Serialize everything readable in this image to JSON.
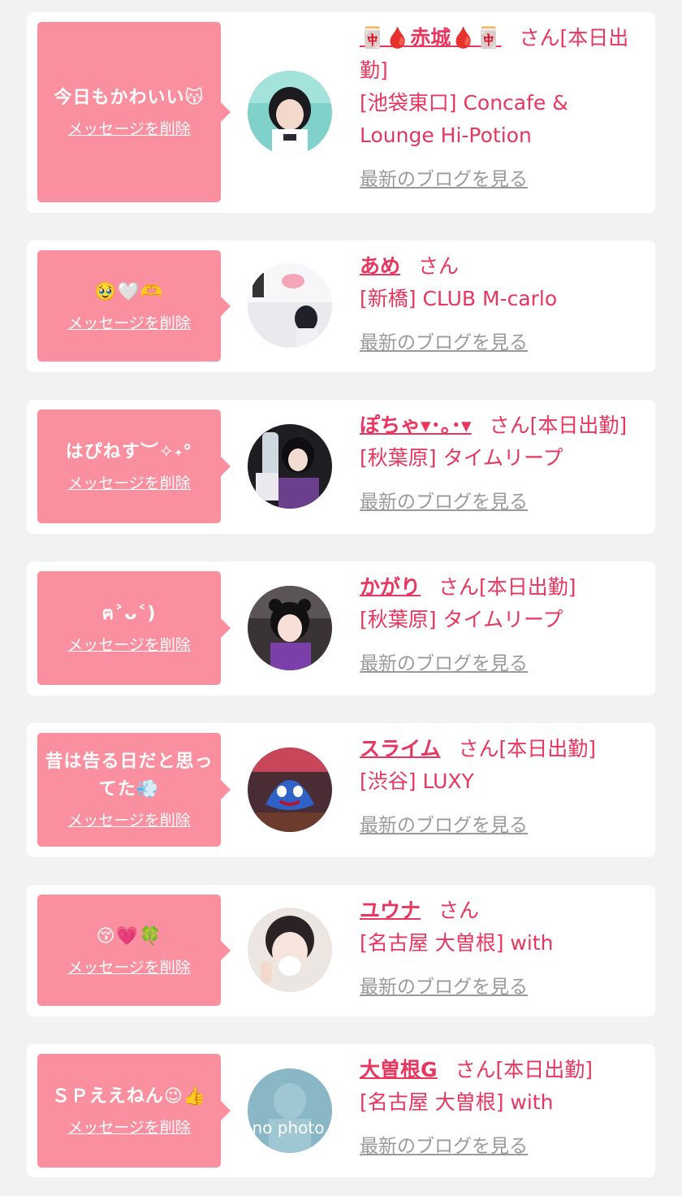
{
  "delete_label": "メッセージを削除",
  "blog_label": "最新のブログを見る",
  "colors": {
    "background": "#f2f2f2",
    "card": "#ffffff",
    "bubble": "#fa8f9f",
    "accent_text": "#e8365f",
    "muted_text": "#9a9a9a"
  },
  "cards": [
    {
      "message": "今日もかわいい😽",
      "name": "🀄🩸赤城🩸🀄",
      "honorific": "さん",
      "status": "[本日出勤]",
      "shop": "[池袋東口] Concafe & Lounge Hi-Potion",
      "avatar_icon": "profile-photo-icon"
    },
    {
      "message": "🥹🤍🫶",
      "name": "あめ",
      "honorific": "さん",
      "status": "",
      "shop": "[新橋] CLUB M-carlo",
      "avatar_icon": "profile-photo-icon"
    },
    {
      "message": "はぴねす︶✧˖°",
      "name": "ぽちゃ▾･｡･▾",
      "honorific": "さん",
      "status": "[本日出勤]",
      "shop": "[秋葉原] タイムリープ",
      "avatar_icon": "profile-photo-icon"
    },
    {
      "message": "ฅ˃ᴗ˂)",
      "name": "かがり",
      "honorific": "さん",
      "status": "[本日出勤]",
      "shop": "[秋葉原] タイムリープ",
      "avatar_icon": "profile-photo-icon"
    },
    {
      "message": "昔は告る日だと思ってた💨",
      "name": "スライム",
      "honorific": "さん",
      "status": "[本日出勤]",
      "shop": "[渋谷] LUXY",
      "avatar_icon": "profile-photo-icon"
    },
    {
      "message": "😚💗🍀",
      "name": "ユウナ",
      "honorific": "さん",
      "status": "",
      "shop": "[名古屋 大曽根] with",
      "avatar_icon": "profile-photo-icon"
    },
    {
      "message": "ＳＰええねん😉👍",
      "name": "大曽根G",
      "honorific": "さん",
      "status": "[本日出勤]",
      "shop": "[名古屋 大曽根] with",
      "avatar_icon": "no-photo-icon",
      "avatar_text": "no photo"
    }
  ]
}
